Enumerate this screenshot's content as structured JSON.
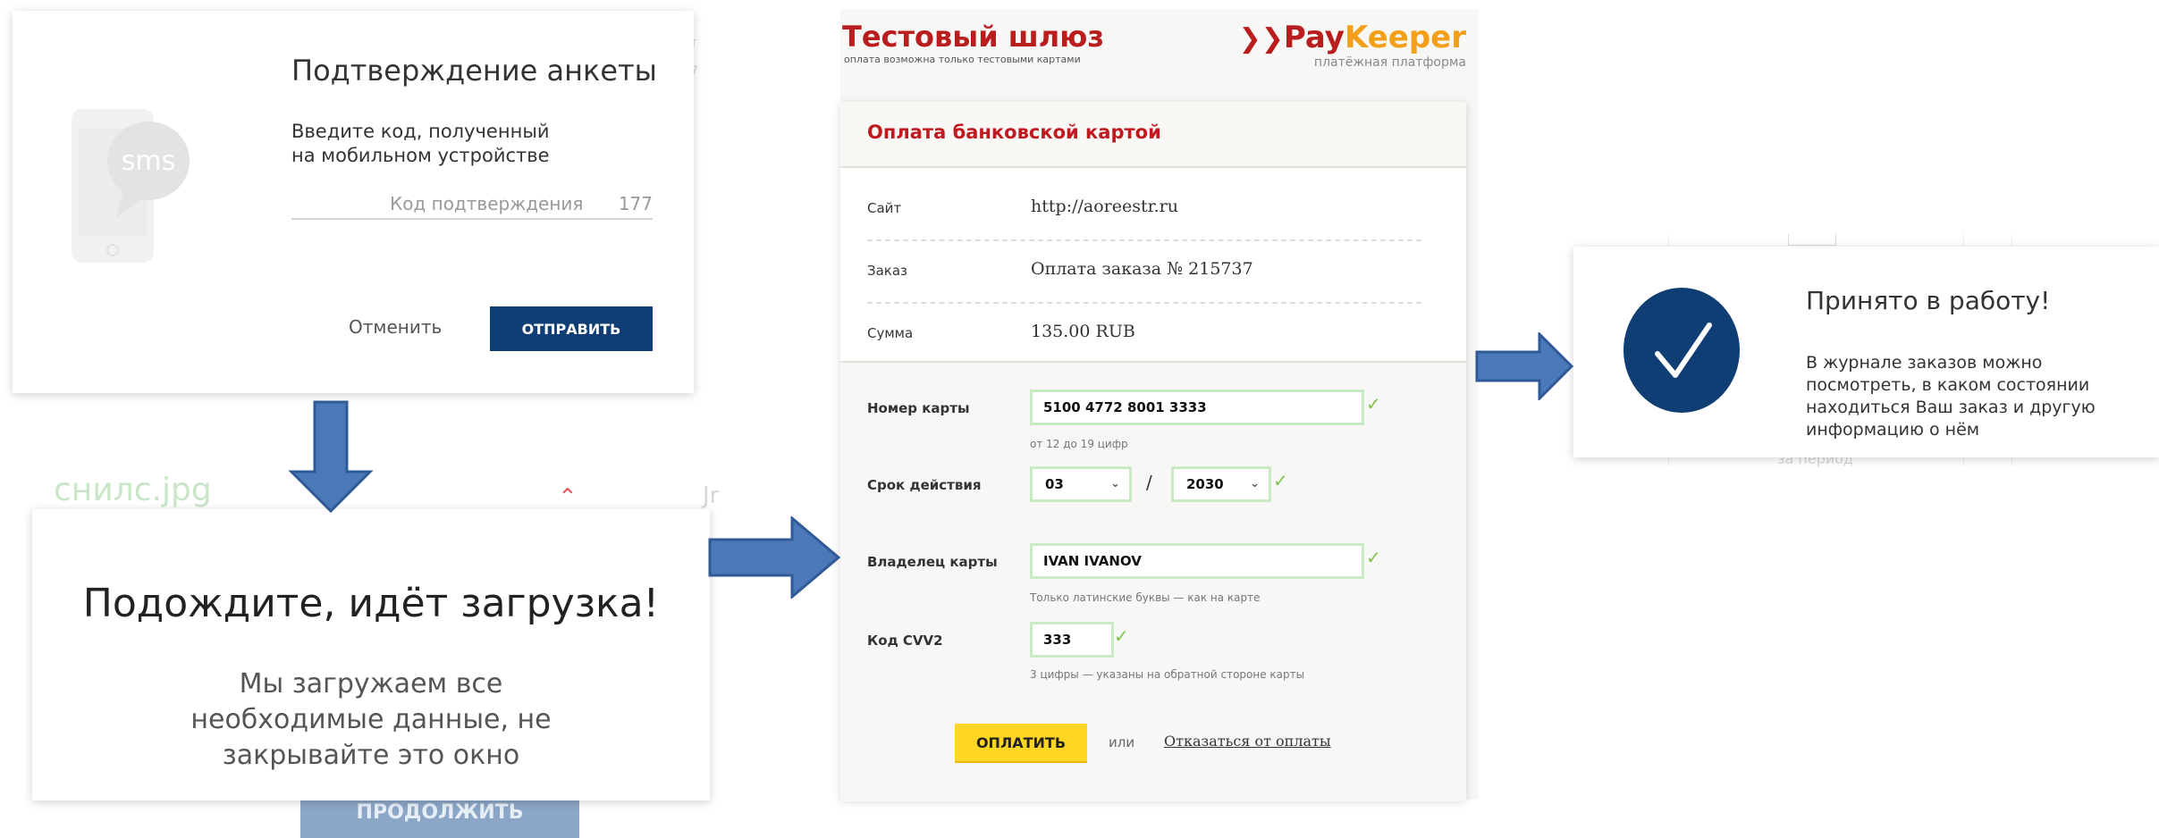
{
  "sms_panel": {
    "title": "Подтверждение анкеты",
    "description": "Введите код, полученный на мобильном устройстве",
    "code_placeholder": "Код подтверждения",
    "counter": "177",
    "cancel_label": "Отменить",
    "send_label": "ОТПРАВИТЬ",
    "sms_badge": "sms",
    "accent_color": "#0f3e74"
  },
  "background_fragments": {
    "file_name": "снилс.jpg",
    "continue_label": "ПРОДОЛЖИТЬ",
    "period_text": "за период"
  },
  "loading_panel": {
    "title": "Подождите, идёт загрузка!",
    "message": "Мы загружаем все необходимые данные, не закрывайте это окно"
  },
  "payment_panel": {
    "gateway_title": "Тестовый шлюз",
    "gateway_subtitle": "оплата возможна только тестовыми картами",
    "brand_pay": "Pay",
    "brand_keeper": "Keeper",
    "brand_subtitle": "платёжная платформа",
    "form_title": "Оплата банковской картой",
    "info_rows": [
      {
        "label": "Сайт",
        "value": "http://aoreestr.ru"
      },
      {
        "label": "Заказ",
        "value": "Оплата заказа № 215737"
      },
      {
        "label": "Сумма",
        "value": "135.00 RUB"
      }
    ],
    "card_number_label": "Номер карты",
    "card_number_value": "5100 4772 8001 3333",
    "card_number_hint": "от 12 до 19 цифр",
    "expiry_label": "Срок действия",
    "expiry_month": "03",
    "expiry_separator": "/",
    "expiry_year": "2030",
    "holder_label": "Владелец карты",
    "holder_value": "IVAN IVANOV",
    "holder_hint": "Только латинские буквы — как на карте",
    "cvv_label": "Код CVV2",
    "cvv_value": "333",
    "cvv_hint": "3 цифры — указаны на обратной стороне карты",
    "pay_label": "ОПЛАТИТЬ",
    "or_text": "или",
    "refuse_label": "Отказаться от оплаты",
    "brand_red": "#b91d1d",
    "brand_orange": "#f2a01a",
    "check_color": "#7fc24a"
  },
  "accepted_panel": {
    "title": "Принято в работу!",
    "message": "В журнале заказов можно посмотреть, в каком состоянии находиться Ваш заказ и другую информацию о нём"
  },
  "icons": [
    "phone-sms-icon",
    "chevron-up-icon",
    "paykeeper-logo-icon",
    "check-icon",
    "chevron-down-icon",
    "checkmark-circle-icon",
    "arrow-right-icon",
    "arrow-down-icon"
  ]
}
